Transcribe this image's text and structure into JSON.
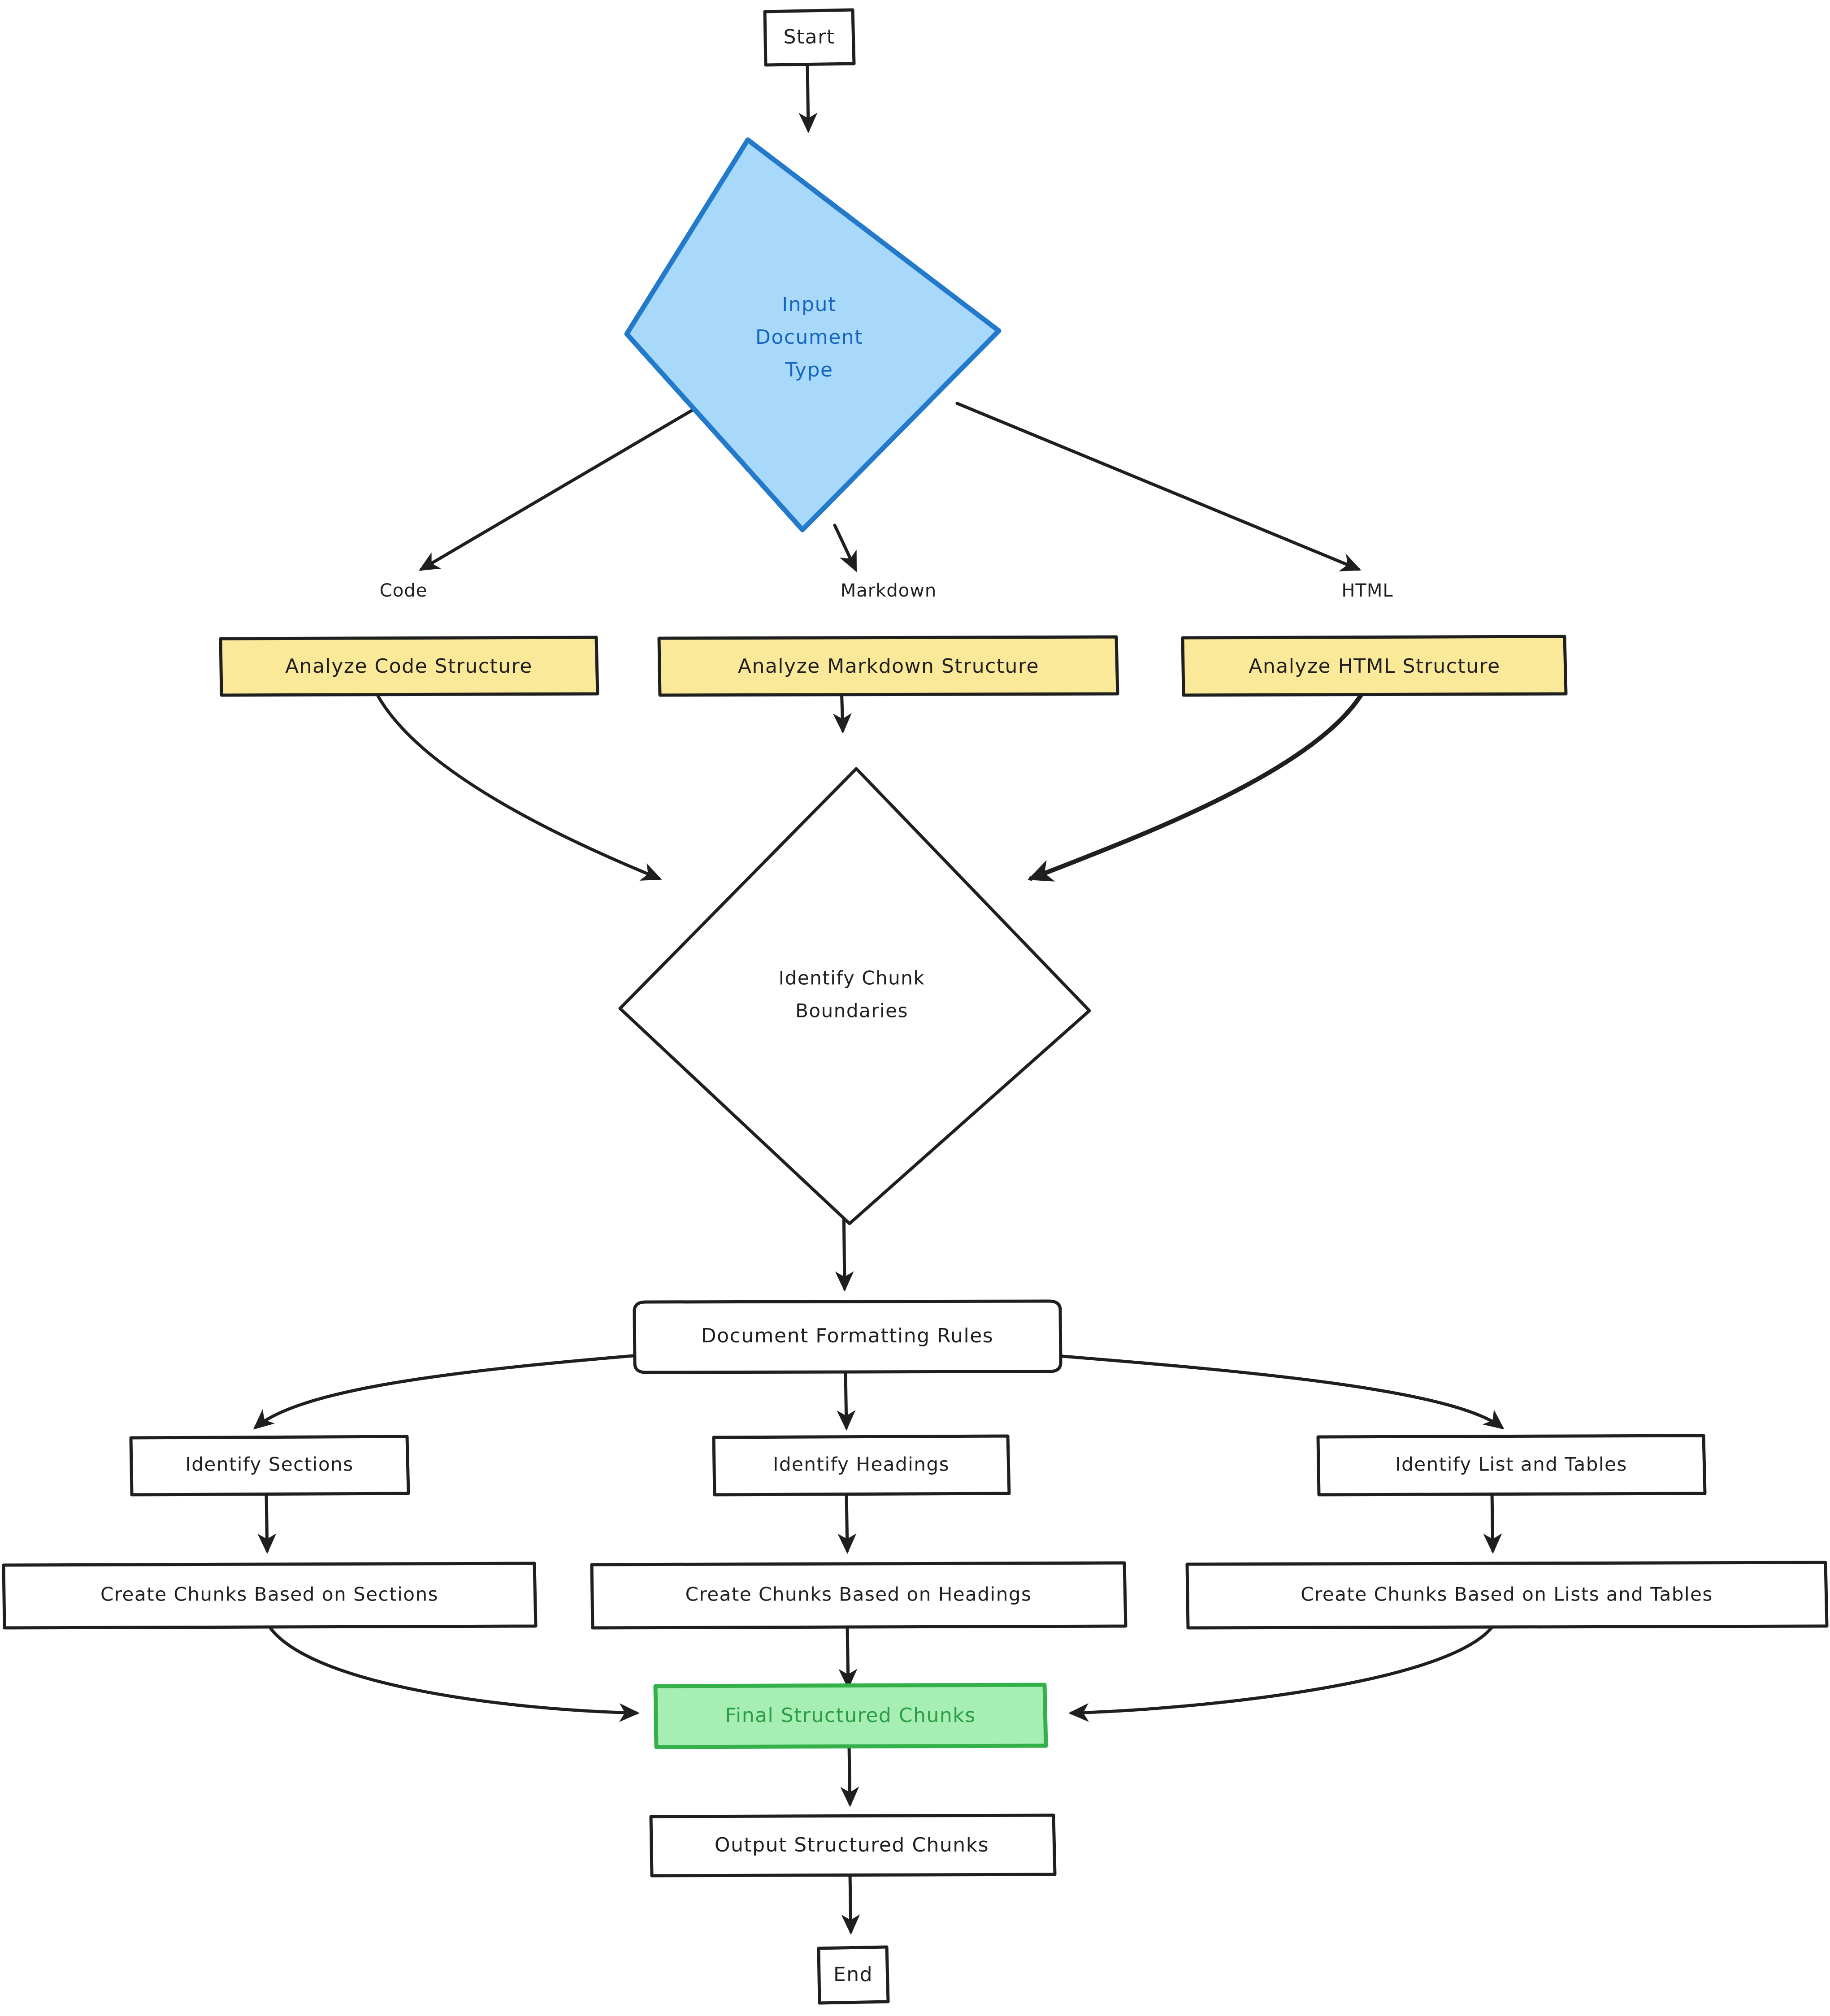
{
  "diagram": {
    "type": "flowchart",
    "title": "Document Chunking Flowchart",
    "orientation": "top-to-bottom"
  },
  "nodes": {
    "start": {
      "label": "Start",
      "shape": "rect",
      "fill": "#ffffff",
      "stroke": "#1f1f1f"
    },
    "input_type": {
      "label_line1": "Input",
      "label_line2": "Document",
      "label_line3": "Type",
      "shape": "diamond",
      "fill": "#a9d9fa",
      "stroke": "#2379ca",
      "text_color": "#1565c0"
    },
    "analyze_code": {
      "label": "Analyze Code Structure",
      "shape": "rect",
      "fill": "#fbe99a",
      "stroke": "#1f1f1f"
    },
    "analyze_markdown": {
      "label": "Analyze Markdown Structure",
      "shape": "rect",
      "fill": "#fbe99a",
      "stroke": "#1f1f1f"
    },
    "analyze_html": {
      "label": "Analyze HTML Structure",
      "shape": "rect",
      "fill": "#fbe99a",
      "stroke": "#1f1f1f"
    },
    "chunk_boundaries": {
      "label_line1": "Identify Chunk",
      "label_line2": "Boundaries",
      "shape": "diamond",
      "fill": "#ffffff",
      "stroke": "#1f1f1f"
    },
    "formatting_rules": {
      "label": "Document Formatting Rules",
      "shape": "rounded-rect",
      "fill": "#ffffff",
      "stroke": "#1f1f1f"
    },
    "identify_sections": {
      "label": "Identify Sections",
      "shape": "rect",
      "fill": "#ffffff",
      "stroke": "#1f1f1f"
    },
    "identify_headings": {
      "label": "Identify Headings",
      "shape": "rect",
      "fill": "#ffffff",
      "stroke": "#1f1f1f"
    },
    "identify_lists_tables": {
      "label": "Identify List and Tables",
      "shape": "rect",
      "fill": "#ffffff",
      "stroke": "#1f1f1f"
    },
    "chunks_sections": {
      "label": "Create Chunks Based on Sections",
      "shape": "rect",
      "fill": "#ffffff",
      "stroke": "#1f1f1f"
    },
    "chunks_headings": {
      "label": "Create Chunks Based on Headings",
      "shape": "rect",
      "fill": "#ffffff",
      "stroke": "#1f1f1f"
    },
    "chunks_lists_tables": {
      "label": "Create Chunks Based on Lists and Tables",
      "shape": "rect",
      "fill": "#ffffff",
      "stroke": "#1f1f1f"
    },
    "final_chunks": {
      "label": "Final Structured Chunks",
      "shape": "rect",
      "fill": "#a6eeb4",
      "stroke": "#34b04b",
      "text_color": "#2a9d45"
    },
    "output_chunks": {
      "label": "Output Structured Chunks",
      "shape": "rect",
      "fill": "#ffffff",
      "stroke": "#1f1f1f"
    },
    "end": {
      "label": "End",
      "shape": "rect",
      "fill": "#ffffff",
      "stroke": "#1f1f1f"
    }
  },
  "edge_labels": {
    "code": "Code",
    "markdown": "Markdown",
    "html": "HTML"
  },
  "edges": [
    {
      "from": "start",
      "to": "input_type",
      "label": ""
    },
    {
      "from": "input_type",
      "to": "analyze_code",
      "label": "Code"
    },
    {
      "from": "input_type",
      "to": "analyze_markdown",
      "label": "Markdown"
    },
    {
      "from": "input_type",
      "to": "analyze_html",
      "label": "HTML"
    },
    {
      "from": "analyze_code",
      "to": "chunk_boundaries",
      "label": ""
    },
    {
      "from": "analyze_markdown",
      "to": "chunk_boundaries",
      "label": ""
    },
    {
      "from": "analyze_html",
      "to": "chunk_boundaries",
      "label": ""
    },
    {
      "from": "chunk_boundaries",
      "to": "formatting_rules",
      "label": ""
    },
    {
      "from": "formatting_rules",
      "to": "identify_sections",
      "label": ""
    },
    {
      "from": "formatting_rules",
      "to": "identify_headings",
      "label": ""
    },
    {
      "from": "formatting_rules",
      "to": "identify_lists_tables",
      "label": ""
    },
    {
      "from": "identify_sections",
      "to": "chunks_sections",
      "label": ""
    },
    {
      "from": "identify_headings",
      "to": "chunks_headings",
      "label": ""
    },
    {
      "from": "identify_lists_tables",
      "to": "chunks_lists_tables",
      "label": ""
    },
    {
      "from": "chunks_sections",
      "to": "final_chunks",
      "label": ""
    },
    {
      "from": "chunks_headings",
      "to": "final_chunks",
      "label": ""
    },
    {
      "from": "chunks_lists_tables",
      "to": "final_chunks",
      "label": ""
    },
    {
      "from": "final_chunks",
      "to": "output_chunks",
      "label": ""
    },
    {
      "from": "output_chunks",
      "to": "end",
      "label": ""
    }
  ],
  "colors": {
    "background": "#ffffff",
    "line": "#1f1f1f",
    "decision_fill": "#a9d9fa",
    "decision_stroke": "#2379ca",
    "decision_text": "#1565c0",
    "process_fill": "#fbe99a",
    "success_fill": "#a6eeb4",
    "success_stroke": "#34b04b",
    "success_text": "#2a9d45"
  }
}
